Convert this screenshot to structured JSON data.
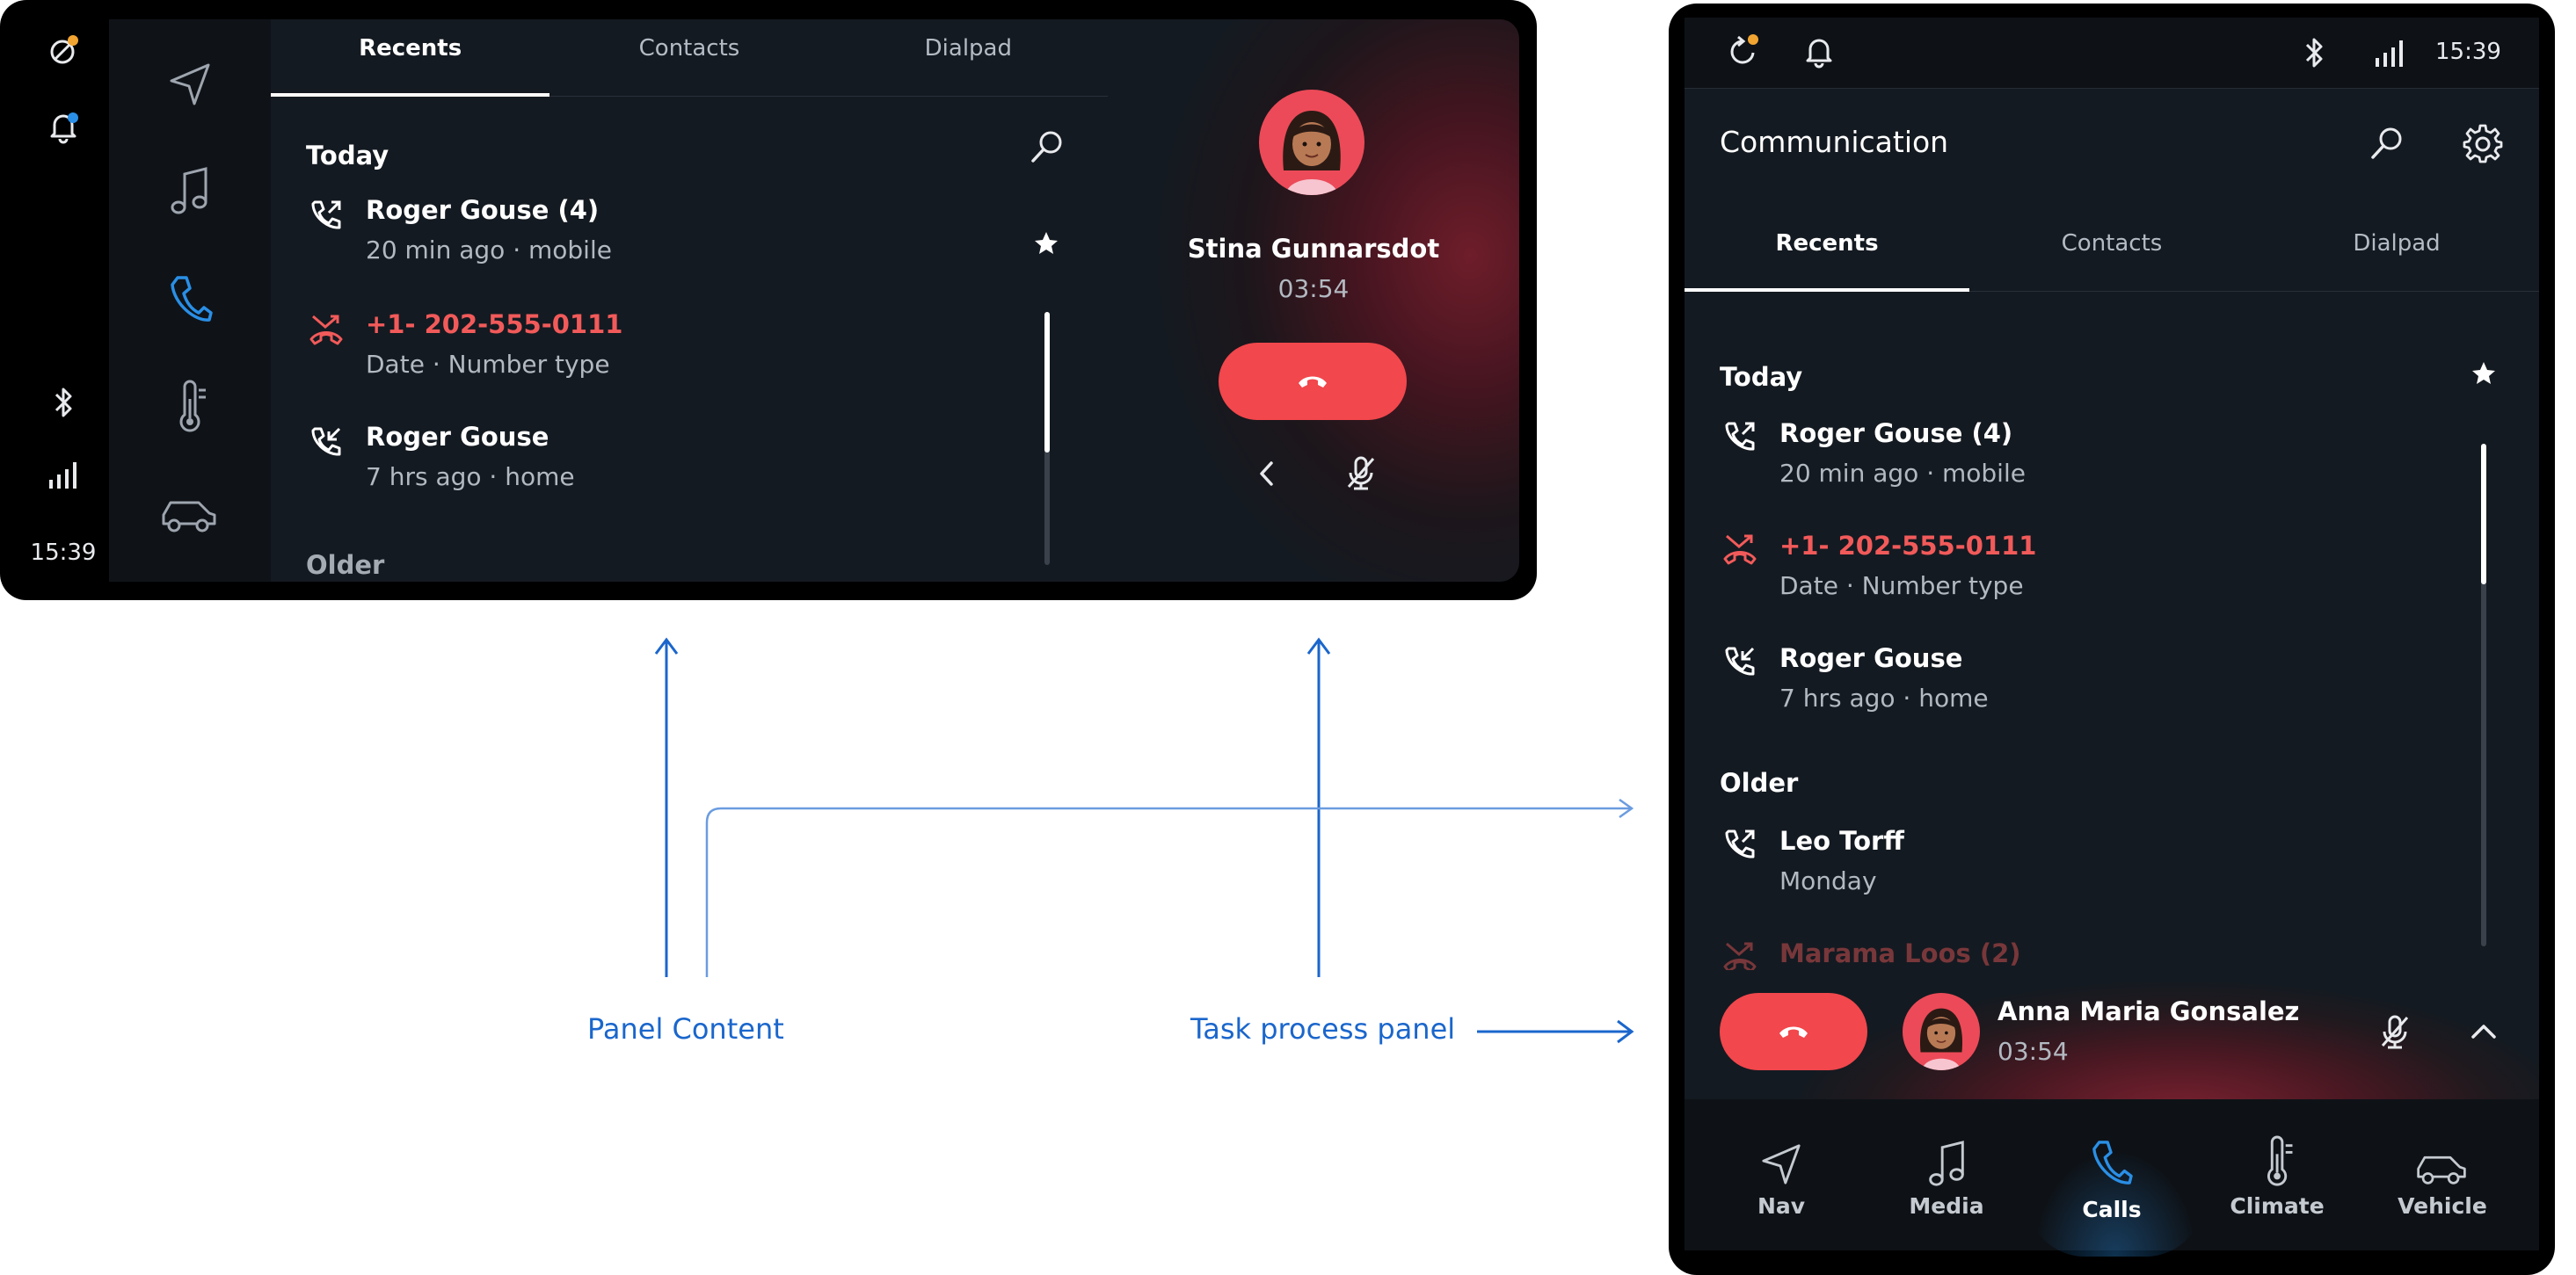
{
  "landscape": {
    "status_bar": {
      "time": "15:39"
    },
    "tabs": [
      {
        "label": "Recents"
      },
      {
        "label": "Contacts"
      },
      {
        "label": "Dialpad"
      }
    ],
    "section_today": "Today",
    "section_older": "Older",
    "calls": [
      {
        "name": "Roger Gouse (4)",
        "detail": "20 min ago · mobile",
        "type": "outgoing"
      },
      {
        "name": "+1- 202-555-0111",
        "detail": "Date · Number type",
        "type": "missed"
      },
      {
        "name": "Roger Gouse",
        "detail": "7 hrs ago · home",
        "type": "incoming"
      }
    ],
    "active_call": {
      "name": "Stina Gunnarsdot",
      "duration": "03:54"
    }
  },
  "portrait": {
    "status_bar": {
      "time": "15:39"
    },
    "title": "Communication",
    "tabs": [
      {
        "label": "Recents"
      },
      {
        "label": "Contacts"
      },
      {
        "label": "Dialpad"
      }
    ],
    "section_today": "Today",
    "section_older": "Older",
    "calls": [
      {
        "name": "Roger Gouse (4)",
        "detail": "20 min ago · mobile",
        "type": "outgoing"
      },
      {
        "name": "+1- 202-555-0111",
        "detail": "Date · Number type",
        "type": "missed"
      },
      {
        "name": "Roger Gouse",
        "detail": "7 hrs ago · home",
        "type": "incoming"
      },
      {
        "name": "Leo Torff",
        "detail": "Monday",
        "type": "outgoing"
      },
      {
        "name": "Marama Loos (2)",
        "detail": "",
        "type": "missed"
      }
    ],
    "task_panel": {
      "name": "Anna Maria Gonsalez",
      "duration": "03:54"
    },
    "bottom_nav": [
      {
        "label": "Nav",
        "icon": "navigation-arrow-icon"
      },
      {
        "label": "Media",
        "icon": "music-note-icon"
      },
      {
        "label": "Calls",
        "icon": "phone-icon"
      },
      {
        "label": "Climate",
        "icon": "thermometer-icon"
      },
      {
        "label": "Vehicle",
        "icon": "car-icon"
      }
    ]
  },
  "annotations": {
    "panel_content": "Panel Content",
    "task_process_panel": "Task process panel"
  },
  "colors": {
    "background_dark": "#141a21",
    "accent_blue": "#2a8fe6",
    "missed_red": "#f25a5a",
    "end_call_red": "#f2474c",
    "annotation_blue": "#1a66cc"
  }
}
